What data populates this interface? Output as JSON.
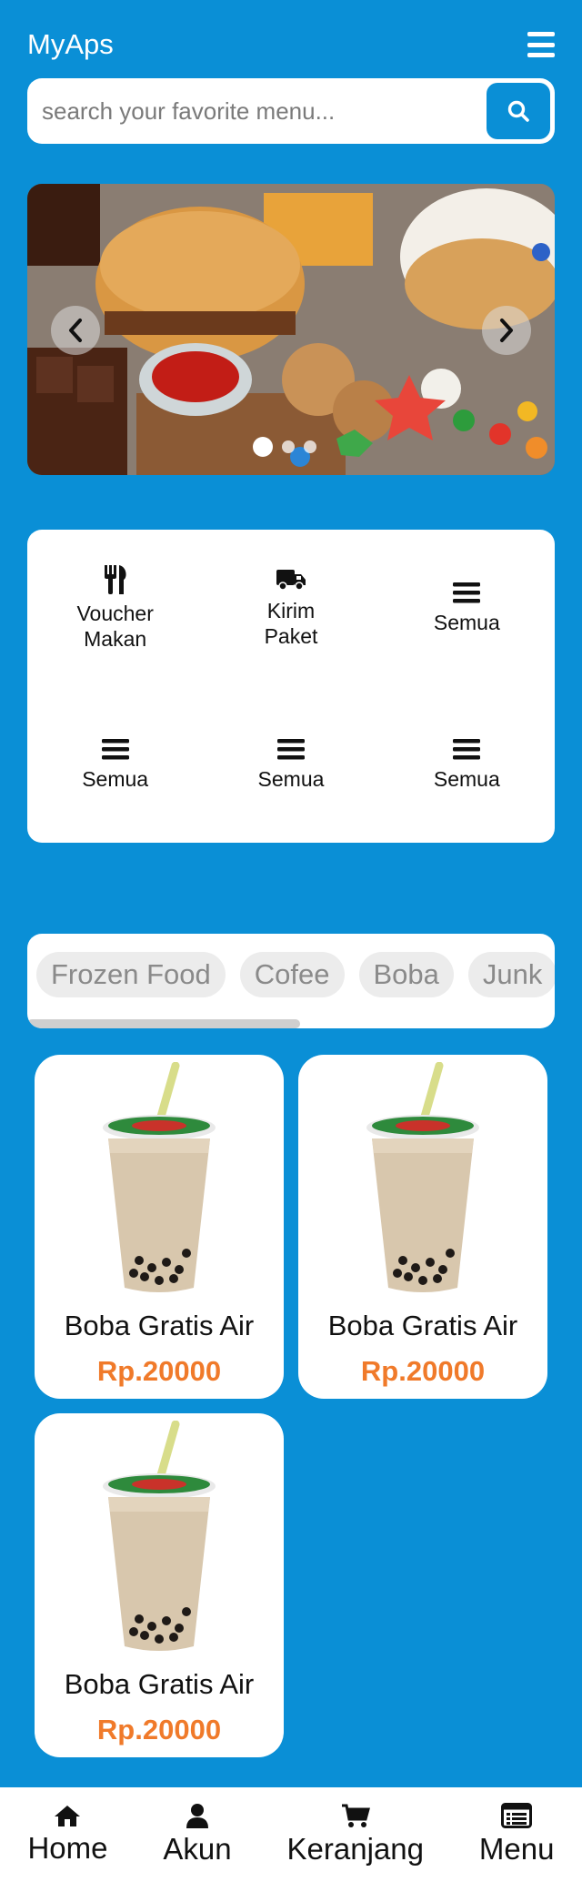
{
  "app": {
    "title": "MyAps"
  },
  "search": {
    "placeholder": "search your favorite menu...",
    "value": ""
  },
  "carousel": {
    "slide_count": 3,
    "active_index": 0
  },
  "categories": [
    {
      "label": "Voucher Makan",
      "icon": "utensils-icon"
    },
    {
      "label": "Kirim Paket",
      "icon": "truck-icon"
    },
    {
      "label": "Semua",
      "icon": "bars-icon"
    },
    {
      "label": "Semua",
      "icon": "bars-icon"
    },
    {
      "label": "Semua",
      "icon": "bars-icon"
    },
    {
      "label": "Semua",
      "icon": "bars-icon"
    }
  ],
  "tabs": [
    "Frozen Food",
    "Cofee",
    "Boba",
    "Junk"
  ],
  "products": [
    {
      "name": "Boba Gratis Air",
      "price": "Rp.20000"
    },
    {
      "name": "Boba Gratis Air",
      "price": "Rp.20000"
    },
    {
      "name": "Boba Gratis Air",
      "price": "Rp.20000"
    }
  ],
  "bottom_nav": [
    {
      "label": "Home",
      "icon": "home-icon"
    },
    {
      "label": "Akun",
      "icon": "user-icon"
    },
    {
      "label": "Keranjang",
      "icon": "cart-icon"
    },
    {
      "label": "Menu",
      "icon": "list-icon"
    }
  ],
  "colors": {
    "background": "#0a8fd6",
    "price": "#f07a2a",
    "chip": "#ececec"
  }
}
